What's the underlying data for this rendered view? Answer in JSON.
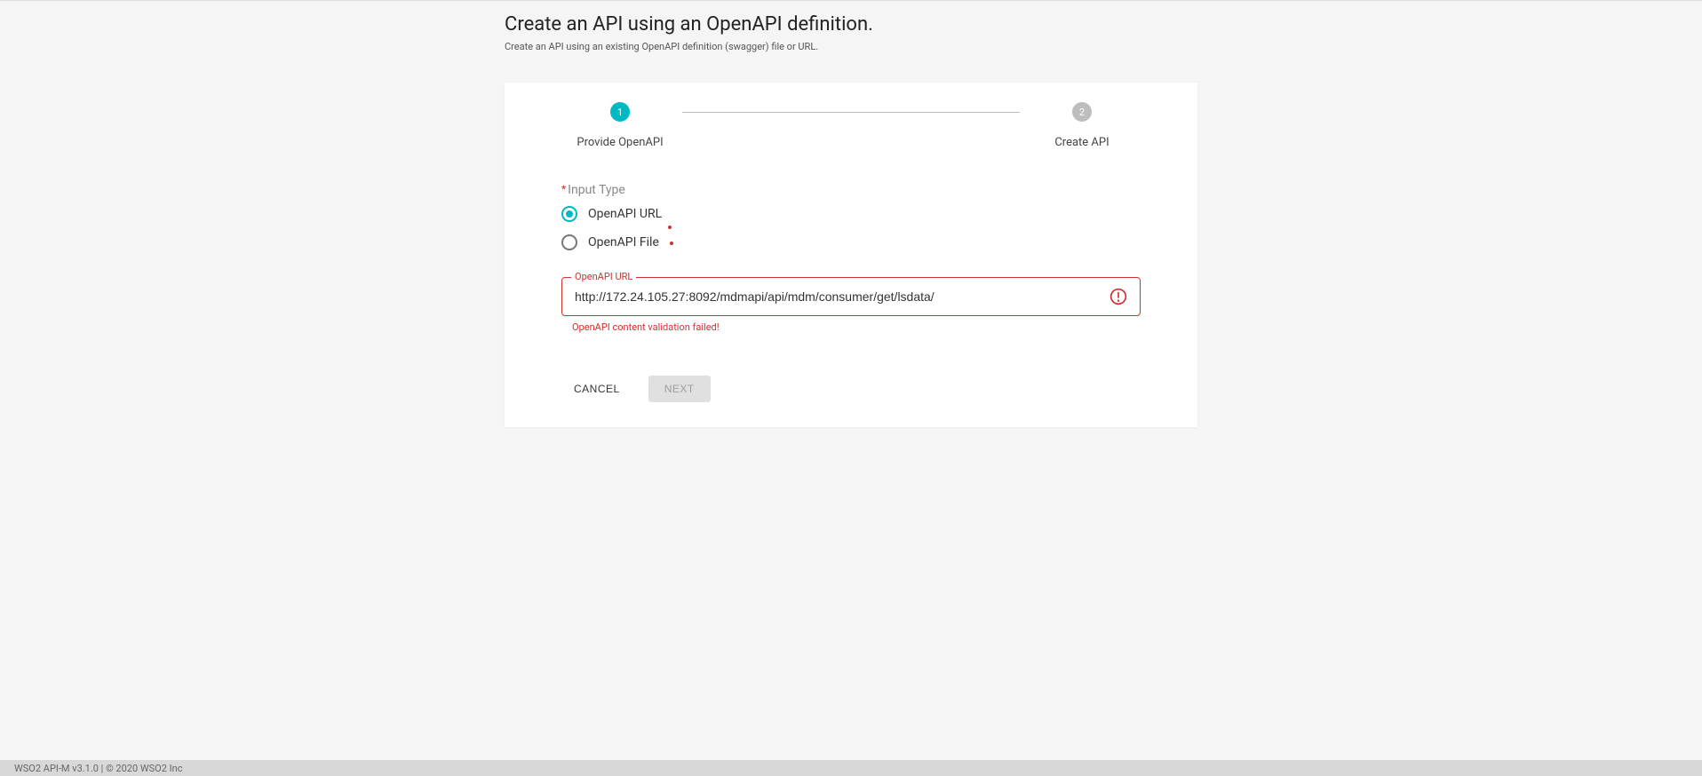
{
  "header": {
    "title": "Create an API using an OpenAPI definition.",
    "subtitle": "Create an API using an existing OpenAPI definition (swagger) file or URL."
  },
  "stepper": {
    "step1": {
      "num": "1",
      "label": "Provide OpenAPI"
    },
    "step2": {
      "num": "2",
      "label": "Create API"
    }
  },
  "form": {
    "input_type_label": "Input Type",
    "radio_url": "OpenAPI URL",
    "radio_file": "OpenAPI File",
    "url_field": {
      "legend": "OpenAPI URL",
      "value": "http://172.24.105.27:8092/mdmapi/api/mdm/consumer/get/lsdata/",
      "helper": "OpenAPI content validation failed!"
    }
  },
  "buttons": {
    "cancel": "CANCEL",
    "next": "NEXT"
  },
  "footer": {
    "text": "WSO2 API-M v3.1.0 | © 2020 WSO2 Inc"
  }
}
